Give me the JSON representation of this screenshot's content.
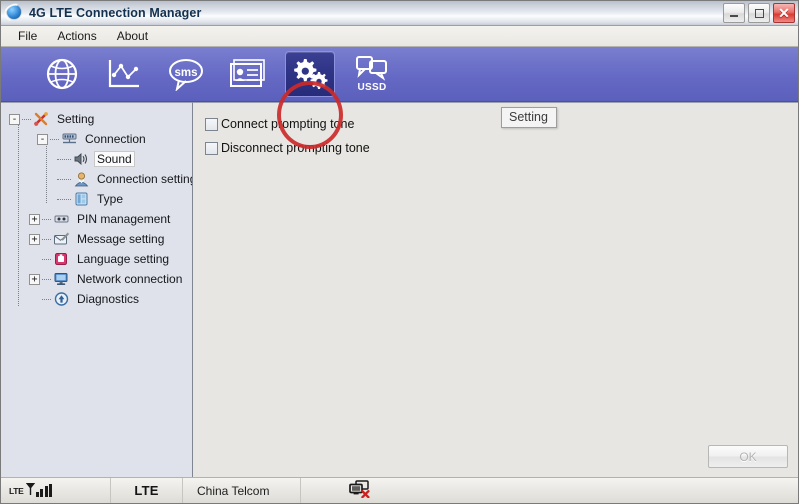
{
  "window": {
    "title": "4G LTE Connection Manager",
    "app_icon": "globe-icon",
    "minimize_label": "—",
    "maximize_label": "□",
    "close_label": "✕"
  },
  "menubar": {
    "items": [
      {
        "label": "File"
      },
      {
        "label": "Actions"
      },
      {
        "label": "About"
      }
    ]
  },
  "toolbar": {
    "buttons": [
      {
        "icon": "globe-icon",
        "label": "",
        "selected": false
      },
      {
        "icon": "statistics-icon",
        "label": "",
        "selected": false
      },
      {
        "icon": "sms-icon",
        "label": "",
        "selected": false
      },
      {
        "icon": "contacts-icon",
        "label": "",
        "selected": false
      },
      {
        "icon": "settings-gears-icon",
        "label": "",
        "selected": true
      },
      {
        "icon": "ussd-icon",
        "label": "USSD",
        "selected": false
      }
    ],
    "annotation": {
      "shape": "circle",
      "color": "#cc2a2a",
      "target": "settings-gears-icon"
    }
  },
  "tree": {
    "nodes": [
      {
        "label": "Setting",
        "icon": "tools-icon",
        "toggle": "-",
        "level": 0,
        "selected": false
      },
      {
        "label": "Connection",
        "icon": "connection-icon",
        "toggle": "-",
        "level": 1,
        "selected": false
      },
      {
        "label": "Sound",
        "icon": "speaker-icon",
        "toggle": "",
        "level": 2,
        "selected": true
      },
      {
        "label": "Connection setting",
        "icon": "user-icon",
        "toggle": "",
        "level": 2,
        "selected": false
      },
      {
        "label": "Type",
        "icon": "type-icon",
        "toggle": "",
        "level": 2,
        "selected": false
      },
      {
        "label": "PIN management",
        "icon": "pin-icon",
        "toggle": "+",
        "level": 1,
        "selected": false
      },
      {
        "label": "Message setting",
        "icon": "message-icon",
        "toggle": "+",
        "level": 1,
        "selected": false
      },
      {
        "label": "Language setting",
        "icon": "language-icon",
        "toggle": "",
        "level": 1,
        "selected": false
      },
      {
        "label": "Network connection",
        "icon": "monitor-icon",
        "toggle": "+",
        "level": 1,
        "selected": false
      },
      {
        "label": "Diagnostics",
        "icon": "diagnostics-icon",
        "toggle": "",
        "level": 1,
        "selected": false
      }
    ]
  },
  "content": {
    "checkboxes": [
      {
        "label": "Connect prompting tone",
        "checked": false
      },
      {
        "label": "Disconnect prompting tone",
        "checked": false
      }
    ],
    "tooltip": {
      "text": "Setting"
    },
    "ok_button": {
      "label": "OK",
      "enabled": false
    }
  },
  "statusbar": {
    "signal_label": "LTE",
    "signal_bars": 4,
    "network_type": "LTE",
    "carrier": "China Telcom",
    "connection_icon": "network-disconnected-icon"
  },
  "colors": {
    "toolbar_accent": "#6569c4",
    "annotation_red": "#cc2a2a",
    "close_button_red": "#d93b33",
    "tree_panel_bg": "#dfe2ea",
    "content_bg": "#e7e6e2"
  }
}
